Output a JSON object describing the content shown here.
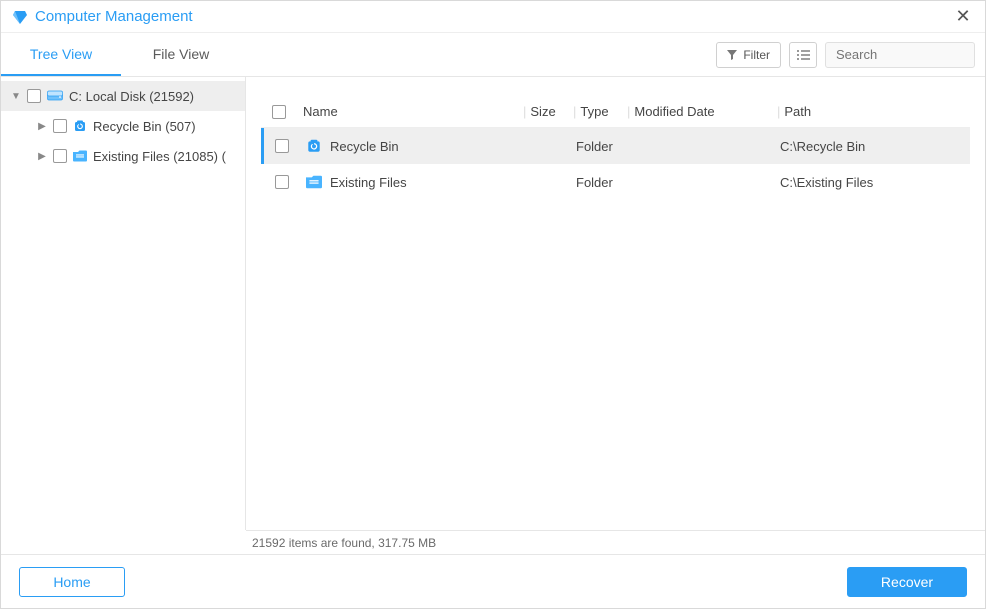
{
  "title": "Computer Management",
  "tabs": {
    "tree": "Tree View",
    "file": "File View"
  },
  "toolbar": {
    "filter_label": "Filter",
    "search_placeholder": "Search"
  },
  "tree": {
    "root": {
      "label": "C: Local Disk (21592)"
    },
    "children": [
      {
        "label": "Recycle Bin (507)"
      },
      {
        "label": "Existing Files (21085) ("
      }
    ]
  },
  "columns": {
    "name": "Name",
    "size": "Size",
    "type": "Type",
    "modified": "Modified Date",
    "path": "Path"
  },
  "rows": [
    {
      "name": "Recycle Bin",
      "size": "",
      "type": "Folder",
      "modified": "",
      "path": "C:\\Recycle Bin",
      "selected": true,
      "icon": "recycle"
    },
    {
      "name": "Existing Files",
      "size": "",
      "type": "Folder",
      "modified": "",
      "path": "C:\\Existing Files",
      "selected": false,
      "icon": "folder"
    }
  ],
  "status": "21592 items are found, 317.75 MB",
  "buttons": {
    "home": "Home",
    "recover": "Recover"
  }
}
